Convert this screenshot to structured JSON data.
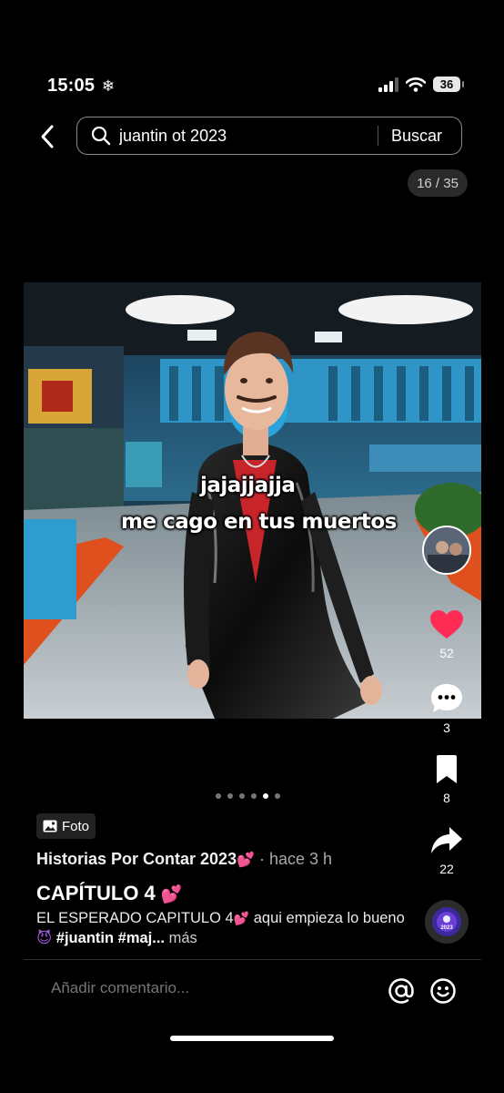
{
  "status_bar": {
    "time": "15:05",
    "battery": "36"
  },
  "search": {
    "query": "juantin ot 2023",
    "submit_label": "Buscar"
  },
  "page_counter": "16 / 35",
  "photo": {
    "caption_line1": "jajajjajja",
    "caption_line2": "me cago en tus muertos"
  },
  "actions": {
    "likes": "52",
    "comments": "3",
    "saves": "8",
    "shares": "22"
  },
  "carousel": {
    "total": 6,
    "active": 4
  },
  "post": {
    "type_badge": "Foto",
    "author": "Historias Por Contar 2023",
    "author_emoji": "💕",
    "time": "· hace 3 h",
    "title": "CAPÍTULO 4",
    "title_emoji": "💕",
    "description_start": "EL ESPERADO CAPITULO 4",
    "description_emoji1": "💕",
    "description_mid": " aqui empieza lo bueno ",
    "description_emoji2": "😈",
    "hashtag1": "#juantin",
    "hashtag2": "#maj...",
    "more_label": "más"
  },
  "music_disc": {
    "label": "2023"
  },
  "comment": {
    "placeholder": "Añadir comentario..."
  },
  "colors": {
    "like": "#ff2c55",
    "background": "#000000",
    "counter_bg": "#2a2a2a"
  }
}
